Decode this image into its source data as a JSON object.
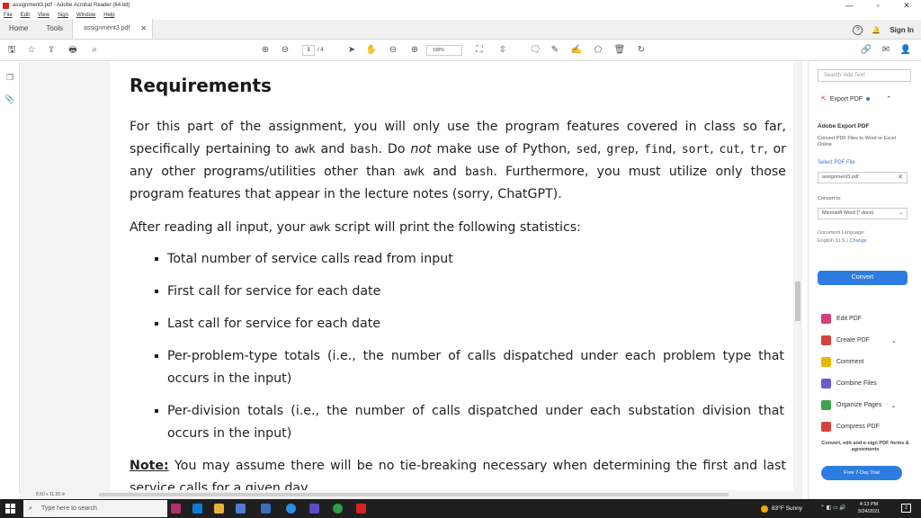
{
  "window": {
    "title": "assignment3.pdf - Adobe Acrobat Reader (64-bit)",
    "minimize": "—",
    "maximize": "▫",
    "close": "✕"
  },
  "menu": [
    "File",
    "Edit",
    "View",
    "Sign",
    "Window",
    "Help"
  ],
  "tabs": {
    "home": "Home",
    "tools": "Tools",
    "document": "assignment3.pdf",
    "close": "✕",
    "signin": "Sign In",
    "help": "?"
  },
  "toolbar": {
    "page_current": "3",
    "page_total": "/ 4",
    "zoom": "100%"
  },
  "document": {
    "heading": "Requirements",
    "p1": {
      "a": "For this part of the assignment, you will only use the program features covered in class so far, specifically pertaining to ",
      "awk1": "awk",
      "b": " and ",
      "bash1": "bash",
      "c": ". Do ",
      "not": "not",
      "d": " make use of Python, ",
      "sed": "sed",
      "e": ", ",
      "grep": "grep",
      "f": ", ",
      "find": "find",
      "g": ", ",
      "sort": "sort",
      "h": ", ",
      "cut": "cut",
      "i": ", ",
      "tr": "tr",
      "j": ", or any other programs/utilities other than ",
      "awk2": "awk",
      "k": " and ",
      "bash2": "bash",
      "l": ". Furthermore, you must utilize only those program features that appear in the lecture notes (sorry, ChatGPT)."
    },
    "p2": {
      "a": "After reading all input, your ",
      "awk": "awk",
      "b": " script will print the following statistics:"
    },
    "bullets": [
      "Total number of service calls read from input",
      "First call for service for each date",
      "Last call for service for each date",
      "Per-problem-type totals (i.e., the number of calls dispatched under each problem type that occurs in the input)",
      "Per-division totals (i.e., the number of calls dispatched under each substation division that occurs in the input)"
    ],
    "note": {
      "label": "Note:",
      "text": " You may assume there will be no tie-breaking necessary when determining the first and last service calls for a given day."
    },
    "page_size": "8.50 x 11.00 in"
  },
  "right_panel": {
    "search_placeholder": "Search 'Add Text'",
    "export_head": "Export PDF",
    "export_title": "Adobe Export PDF",
    "export_desc": "Convert PDF Files to Word or Excel Online",
    "select_file": "Select PDF File",
    "file_name": "assignment3.pdf",
    "convert_to": "Convert to",
    "format": "Microsoft Word (*.docx)",
    "doc_language_label": "Document Language:",
    "doc_language": "English (U.S.)",
    "change": "Change",
    "convert_button": "Convert",
    "tools": [
      {
        "label": "Edit PDF",
        "color": "#d23f7a"
      },
      {
        "label": "Create PDF",
        "color": "#d9403a"
      },
      {
        "label": "Comment",
        "color": "#e8b800"
      },
      {
        "label": "Combine Files",
        "color": "#6b5bd2"
      },
      {
        "label": "Organize Pages",
        "color": "#3fa34d"
      },
      {
        "label": "Compress PDF",
        "color": "#d9403a"
      }
    ],
    "promo": "Convert, edit and e-sign PDF forms & agreements",
    "trial_button": "Free 7-Day Trial"
  },
  "taskbar": {
    "search_placeholder": "Type here to search",
    "weather": "83°F  Sunny",
    "time": "4:13 PM",
    "date": "3/24/2021",
    "notification_count": "2"
  }
}
